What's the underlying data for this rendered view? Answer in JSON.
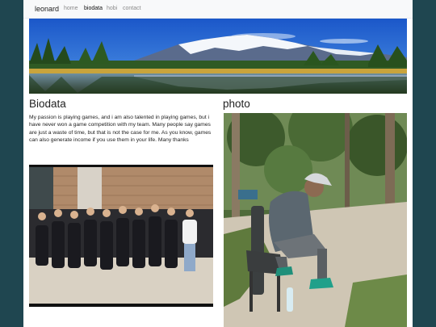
{
  "nav": {
    "brand": "leonard",
    "links": [
      "home",
      "biodata",
      "hobi",
      "contact"
    ],
    "active": "biodata"
  },
  "biodata": {
    "title": "Biodata",
    "text": "My passion is playing games, and i am also talented in playing games, but i have never won a game competition with my team. Many people say games are just a waste of time, but that is not the case for me. As you know, games can also generate income if you use them in your life. Many thanks"
  },
  "photo": {
    "title": "photo"
  },
  "colors": {
    "background": "#1f4650",
    "navbar": "#f8f9fa",
    "nav_inactive": "#8a8a8a",
    "text": "#222222"
  }
}
